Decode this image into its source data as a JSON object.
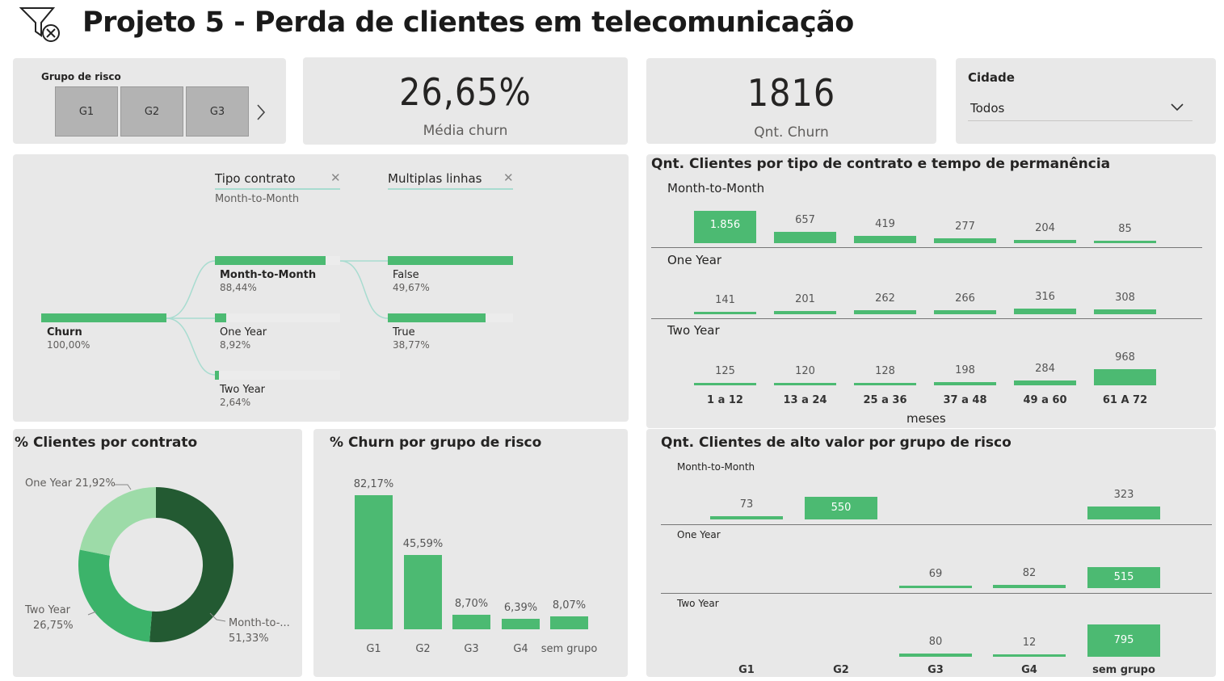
{
  "header": {
    "title": "Projeto 5 - Perda de clientes em telecomunicação",
    "logo_icon": "filter-x-icon"
  },
  "risk_slicer": {
    "title": "Grupo de risco",
    "tiles": [
      "G1",
      "G2",
      "G3"
    ],
    "next_icon": "chevron-right-icon"
  },
  "kpi_churn_rate": {
    "value": "26,65%",
    "label": "Média churn"
  },
  "kpi_churn_count": {
    "value": "1816",
    "label": "Qnt. Churn"
  },
  "city_slicer": {
    "title": "Cidade",
    "selected": "Todos"
  },
  "decomposition_tree": {
    "level1_header": "Tipo contrato",
    "level1_filter": "Month-to-Month",
    "level2_header": "Multiplas linhas",
    "root": {
      "label": "Churn",
      "pct": "100,00%",
      "fraction": 1.0
    },
    "contract_nodes": [
      {
        "label": "Month-to-Month",
        "pct": "88,44%",
        "fraction": 0.8844
      },
      {
        "label": "One Year",
        "pct": "8,92%",
        "fraction": 0.0892
      },
      {
        "label": "Two Year",
        "pct": "2,64%",
        "fraction": 0.0264
      }
    ],
    "line_nodes": [
      {
        "label": "False",
        "pct": "49,67%",
        "fraction": 1.0
      },
      {
        "label": "True",
        "pct": "38,77%",
        "fraction": 0.78
      }
    ]
  },
  "tenure_matrix": {
    "title": "Qnt. Clientes por tipo de contrato e tempo de permanência",
    "rows": [
      "Month-to-Month",
      "One Year",
      "Two Year"
    ],
    "columns": [
      "1 a 12",
      "13 a 24",
      "25 a 36",
      "37 a 48",
      "49 a 60",
      "61 A 72"
    ],
    "axis_label": "meses",
    "value_labels": [
      [
        "1.856",
        "657",
        "419",
        "277",
        "204",
        "85"
      ],
      [
        "141",
        "201",
        "262",
        "266",
        "316",
        "308"
      ],
      [
        "125",
        "120",
        "128",
        "198",
        "284",
        "968"
      ]
    ]
  },
  "donut": {
    "title": "% Clientes por contrato",
    "label_one_year": "One Year 21,92%",
    "label_two_year_name": "Two Year",
    "label_two_year_pct": "26,75%",
    "label_mtm_name": "Month-to-...",
    "label_mtm_pct": "51,33%",
    "colors": [
      "#235a32",
      "#3cb36a",
      "#9ddba8"
    ]
  },
  "high_value_matrix": {
    "title": "Qnt. Clientes de alto valor por grupo de risco",
    "rows": [
      "Month-to-Month",
      "One Year",
      "Two Year"
    ],
    "columns": [
      "G1",
      "G2",
      "G3",
      "G4",
      "sem grupo"
    ],
    "value_labels": [
      [
        "73",
        "550",
        "",
        "",
        "323"
      ],
      [
        "",
        "",
        "69",
        "82",
        "515"
      ],
      [
        "",
        "",
        "80",
        "12",
        "795"
      ]
    ]
  },
  "chart_data": [
    {
      "type": "bar",
      "title": "% Churn por grupo de risco",
      "categories": [
        "G1",
        "G2",
        "G3",
        "G4",
        "sem grupo"
      ],
      "values": [
        82.17,
        45.59,
        8.7,
        6.39,
        8.07
      ],
      "data_labels": [
        "82,17%",
        "45,59%",
        "8,70%",
        "6,39%",
        "8,07%"
      ],
      "xlabel": "",
      "ylabel": ""
    },
    {
      "type": "pie",
      "title": "% Clientes por contrato",
      "categories": [
        "Month-to-Month",
        "Two Year",
        "One Year"
      ],
      "values": [
        51.33,
        26.75,
        21.92
      ]
    },
    {
      "type": "bar",
      "title": "Qnt. Clientes por tipo de contrato e tempo de permanência",
      "categories": [
        "1 a 12",
        "13 a 24",
        "25 a 36",
        "37 a 48",
        "49 a 60",
        "61 A 72"
      ],
      "xlabel": "meses",
      "series": [
        {
          "name": "Month-to-Month",
          "values": [
            1856,
            657,
            419,
            277,
            204,
            85
          ]
        },
        {
          "name": "One Year",
          "values": [
            141,
            201,
            262,
            266,
            316,
            308
          ]
        },
        {
          "name": "Two Year",
          "values": [
            125,
            120,
            128,
            198,
            284,
            968
          ]
        }
      ]
    },
    {
      "type": "bar",
      "title": "Qnt. Clientes de alto valor por grupo de risco",
      "categories": [
        "G1",
        "G2",
        "G3",
        "G4",
        "sem grupo"
      ],
      "series": [
        {
          "name": "Month-to-Month",
          "values": [
            73,
            550,
            0,
            0,
            323
          ]
        },
        {
          "name": "One Year",
          "values": [
            0,
            0,
            69,
            82,
            515
          ]
        },
        {
          "name": "Two Year",
          "values": [
            0,
            0,
            80,
            12,
            795
          ]
        }
      ]
    }
  ]
}
